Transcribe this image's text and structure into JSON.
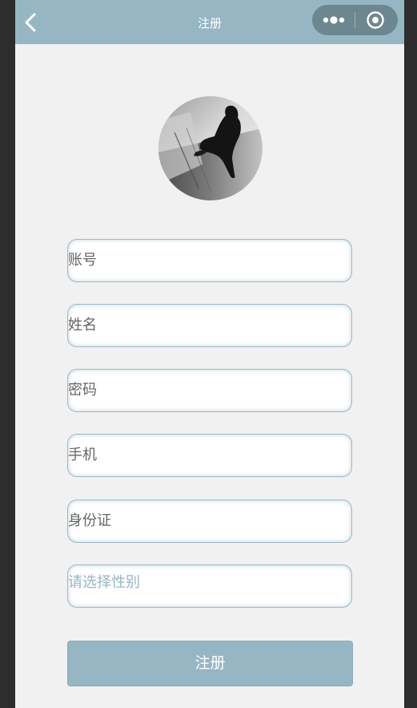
{
  "navbar": {
    "title": "注册",
    "back_icon": "chevron-left-icon",
    "more_icon": "more-dots-icon",
    "close_icon": "target-circle-icon",
    "background": "#96b6c3"
  },
  "avatar": {
    "description_icon": "avatar-photo"
  },
  "form": {
    "fields": [
      {
        "placeholder": "账号"
      },
      {
        "placeholder": "姓名"
      },
      {
        "placeholder": "密码"
      },
      {
        "placeholder": "手机"
      },
      {
        "placeholder": "身份证"
      }
    ],
    "gender_picker": {
      "placeholder": "请选择性别"
    },
    "submit_label": "注册"
  },
  "colors": {
    "accent": "#96b6c3",
    "page_background": "#f1f1f1",
    "placeholder_text": "#666666",
    "picker_text": "#96b6c3"
  }
}
